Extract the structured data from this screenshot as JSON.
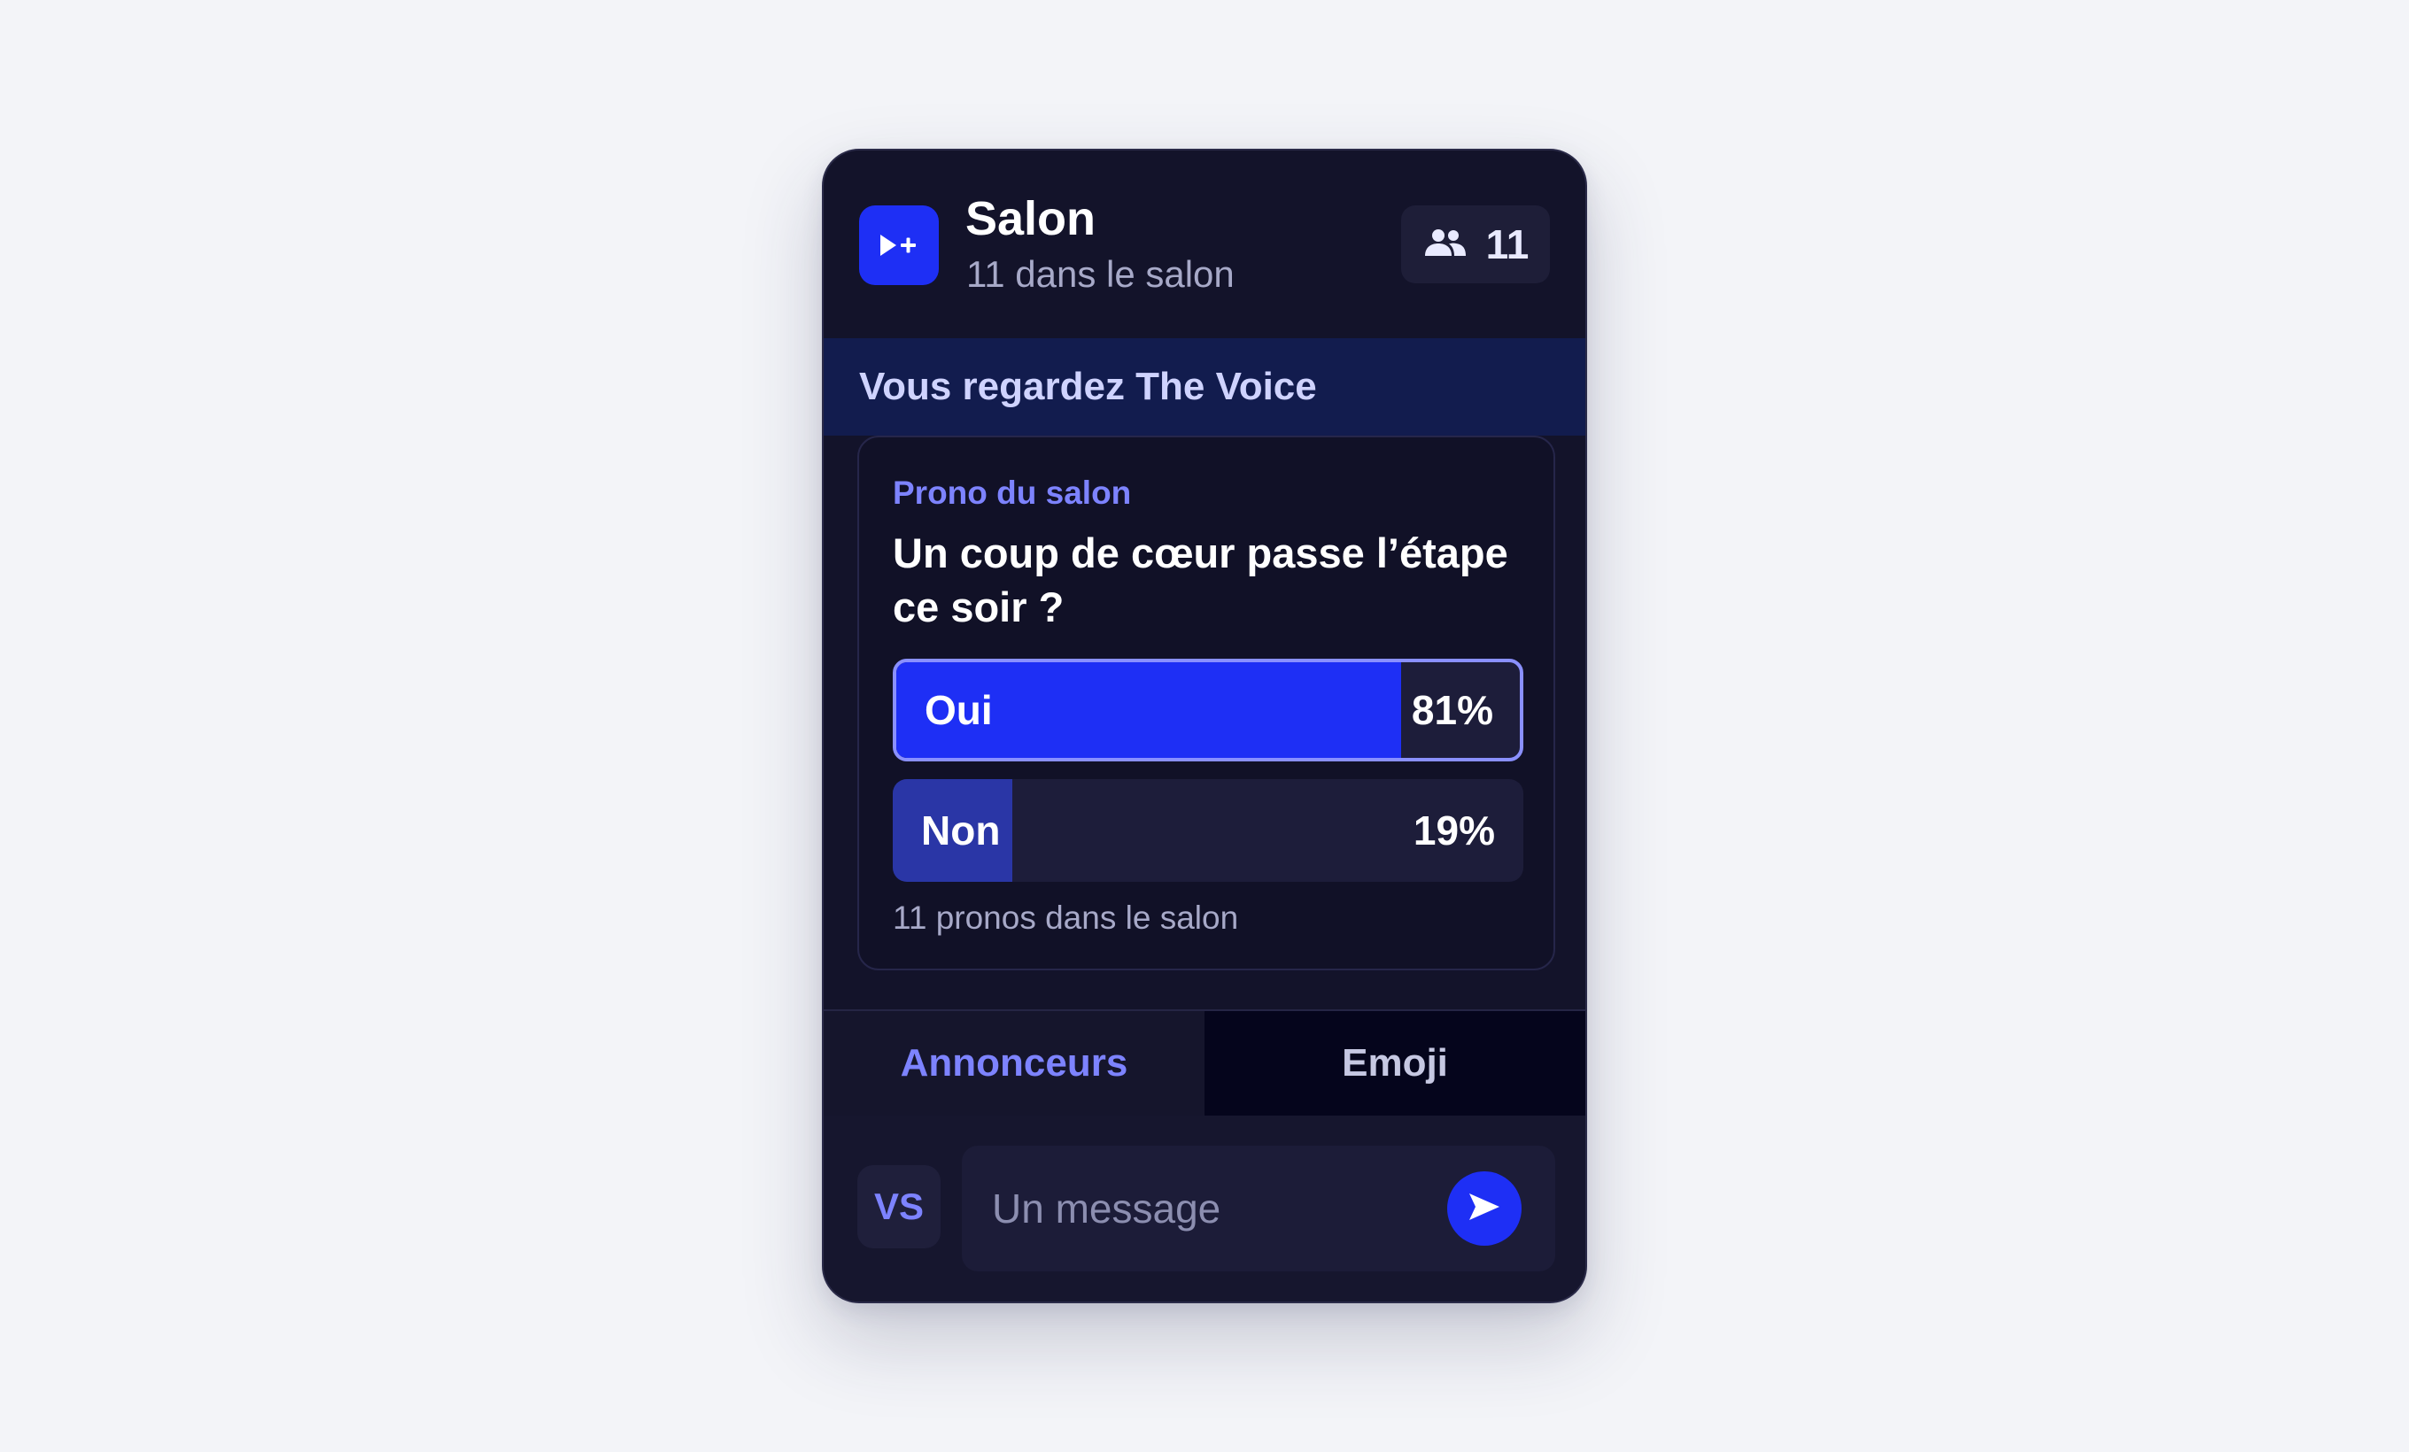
{
  "colors": {
    "accent": "#1e2ff5",
    "accent_light": "#7d83ff",
    "card_bg": "#13132a",
    "banner_bg": "#121c4e",
    "non_fill": "#2a36a6"
  },
  "header": {
    "logo_icon": "play-plus-icon",
    "title": "Salon",
    "subtitle": "11 dans le salon",
    "member_icon": "people-icon",
    "member_count": "11"
  },
  "banner": {
    "text": "Vous regardez The Voice"
  },
  "poll": {
    "label": "Prono du salon",
    "question": "Un coup de cœur passe l’étape ce soir ?",
    "options": [
      {
        "label": "Oui",
        "percent_text": "81%",
        "percent": 81,
        "selected": true
      },
      {
        "label": "Non",
        "percent_text": "19%",
        "percent": 19,
        "selected": false
      }
    ],
    "footer": "11 pronos dans le salon"
  },
  "tabs": [
    {
      "label": "Annonceurs",
      "active": true
    },
    {
      "label": "Emoji",
      "active": false
    }
  ],
  "composer": {
    "avatar_initials": "VS",
    "placeholder": "Un message",
    "value": "",
    "send_icon": "send-arrow-icon"
  }
}
